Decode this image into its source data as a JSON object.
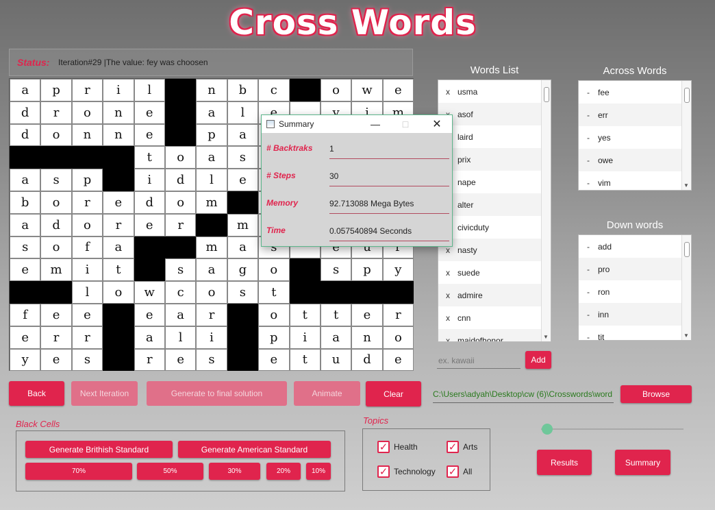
{
  "app": {
    "title": "Cross Words"
  },
  "status": {
    "label": "Status:",
    "text": "Iteration#29 |The value: fey was choosen"
  },
  "grid": {
    "rows": [
      [
        "a",
        "p",
        "r",
        "i",
        "l",
        "#",
        "n",
        "b",
        "c",
        "#",
        "o",
        "w",
        "e"
      ],
      [
        "d",
        "r",
        "o",
        "n",
        "e",
        "#",
        "a",
        "l",
        "e",
        "",
        "y",
        "i",
        "m"
      ],
      [
        "d",
        "o",
        "n",
        "n",
        "e",
        "#",
        "p",
        "a",
        "",
        "",
        "",
        "",
        ""
      ],
      [
        "#",
        "#",
        "#",
        "#",
        "t",
        "o",
        "a",
        "s",
        "",
        "",
        "",
        "",
        ""
      ],
      [
        "a",
        "s",
        "p",
        "#",
        "i",
        "d",
        "l",
        "e",
        "",
        "",
        "",
        "",
        ""
      ],
      [
        "b",
        "o",
        "r",
        "e",
        "d",
        "o",
        "m",
        "#",
        "",
        "",
        "",
        "",
        ""
      ],
      [
        "a",
        "d",
        "o",
        "r",
        "e",
        "r",
        "#",
        "m",
        "",
        "",
        "",
        "",
        ""
      ],
      [
        "s",
        "o",
        "f",
        "a",
        "#",
        "#",
        "m",
        "a",
        "s",
        "",
        "e",
        "u",
        "r"
      ],
      [
        "e",
        "m",
        "i",
        "t",
        "#",
        "s",
        "a",
        "g",
        "o",
        "#",
        "s",
        "p",
        "y"
      ],
      [
        "#",
        "#",
        "l",
        "o",
        "w",
        "c",
        "o",
        "s",
        "t",
        "#",
        "#",
        "#",
        "#"
      ],
      [
        "f",
        "e",
        "e",
        "#",
        "e",
        "a",
        "r",
        "#",
        "o",
        "t",
        "t",
        "e",
        "r"
      ],
      [
        "e",
        "r",
        "r",
        "#",
        "a",
        "l",
        "i",
        "#",
        "p",
        "i",
        "a",
        "n",
        "o"
      ],
      [
        "y",
        "e",
        "s",
        "#",
        "r",
        "e",
        "s",
        "#",
        "e",
        "t",
        "u",
        "d",
        "e"
      ]
    ]
  },
  "controls": {
    "back": "Back",
    "next_iteration": "Next Iteration",
    "generate_final": "Generate to final solution",
    "animate": "Animate",
    "clear": "Clear",
    "browse": "Browse",
    "add": "Add",
    "results": "Results",
    "summary": "Summary"
  },
  "words_list": {
    "title": "Words List",
    "items": [
      {
        "mark": "x",
        "word": "usma"
      },
      {
        "mark": "x",
        "word": "asof"
      },
      {
        "mark": "",
        "word": "laird"
      },
      {
        "mark": "",
        "word": "prix"
      },
      {
        "mark": "",
        "word": "nape"
      },
      {
        "mark": "",
        "word": "alter"
      },
      {
        "mark": "",
        "word": "civicduty"
      },
      {
        "mark": "x",
        "word": "nasty"
      },
      {
        "mark": "x",
        "word": "suede"
      },
      {
        "mark": "x",
        "word": "admire"
      },
      {
        "mark": "x",
        "word": "cnn"
      },
      {
        "mark": "x",
        "word": "maidofhonor"
      }
    ]
  },
  "across_words": {
    "title": "Across Words",
    "items": [
      "fee",
      "err",
      "yes",
      "owe",
      "vim"
    ]
  },
  "down_words": {
    "title": "Down words",
    "items": [
      "add",
      "pro",
      "ron",
      "inn",
      "tit"
    ]
  },
  "word_input": {
    "placeholder": "ex. kawaii"
  },
  "file_path": "C:\\Users\\adyah\\Desktop\\cw (6)\\Crosswords\\word",
  "black_cells": {
    "title": "Black Cells",
    "british": "Generate Brithish Standard",
    "american": "Generate American Standard",
    "percents": [
      "70%",
      "50%",
      "30%",
      "20%",
      "10%"
    ]
  },
  "topics": {
    "title": "Topics",
    "items": [
      {
        "label": "Health",
        "checked": true
      },
      {
        "label": "Arts",
        "checked": true
      },
      {
        "label": "Technology",
        "checked": true
      },
      {
        "label": "All",
        "checked": true
      }
    ]
  },
  "summary_dialog": {
    "title": "Summary",
    "rows": [
      {
        "label": "# Backtraks",
        "value": "1"
      },
      {
        "label": "# Steps",
        "value": "30"
      },
      {
        "label": "Memory",
        "value": "92.713088 Mega Bytes"
      },
      {
        "label": "Time",
        "value": "0.057540894 Seconds"
      }
    ]
  },
  "colors": {
    "accent": "#e0244d",
    "path_text": "#2a7a1e",
    "slider": "#6fc79a"
  }
}
